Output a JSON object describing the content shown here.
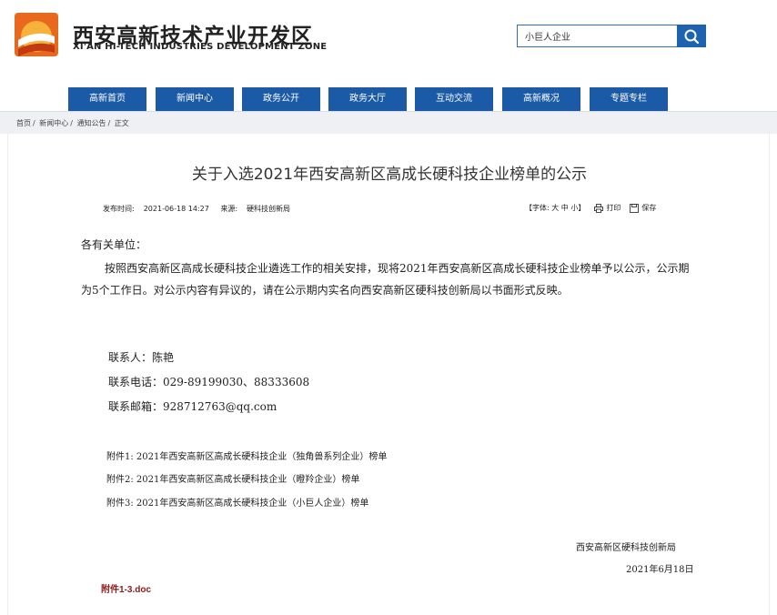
{
  "header": {
    "logo_title": "西安高新技术产业开发区",
    "logo_subtitle": "XI'AN HI-TECH INDUSTRIES DEVELOPMENT ZONE",
    "search_value": "小巨人企业"
  },
  "nav": [
    "高新首页",
    "新闻中心",
    "政务公开",
    "政务大厅",
    "互动交流",
    "高新概况",
    "专题专栏"
  ],
  "breadcrumb": [
    "首页",
    "新闻中心",
    "通知公告",
    "正文"
  ],
  "article": {
    "title": "关于入选2021年西安高新区高成长硬科技企业榜单的公示",
    "publish_label": "发布时间:",
    "publish_time": "2021-06-18 14:27",
    "source_label": "来源:",
    "source": "硬科技创新局",
    "font_label": "【字体: 大 中 小】",
    "print_label": "打印",
    "save_label": "保存",
    "salutation": "各有关单位：",
    "paragraph": "按照西安高新区高成长硬科技企业遴选工作的相关安排，现将2021年西安高新区高成长硬科技企业榜单予以公示，公示期为5个工作日。对公示内容有异议的，请在公示期内实名向西安高新区硬科技创新局以书面形式反映。",
    "contacts": [
      "联系人：陈艳",
      "联系电话：029-89199030、88333608",
      "联系邮箱：928712763@qq.com"
    ],
    "attachments": [
      "附件1: 2021年西安高新区高成长硬科技企业（独角兽系列企业）榜单",
      "附件2: 2021年西安高新区高成长硬科技企业（瞪羚企业）榜单",
      "附件3: 2021年西安高新区高成长硬科技企业（小巨人企业）榜单"
    ],
    "signature_org": "西安高新区硬科技创新局",
    "signature_date": "2021年6月18日",
    "download_link": "附件1-3.doc"
  },
  "colors": {
    "nav_bg": "#1b5aa6",
    "logo_orange": "#e8681e",
    "link_red": "#8b1a1a"
  }
}
